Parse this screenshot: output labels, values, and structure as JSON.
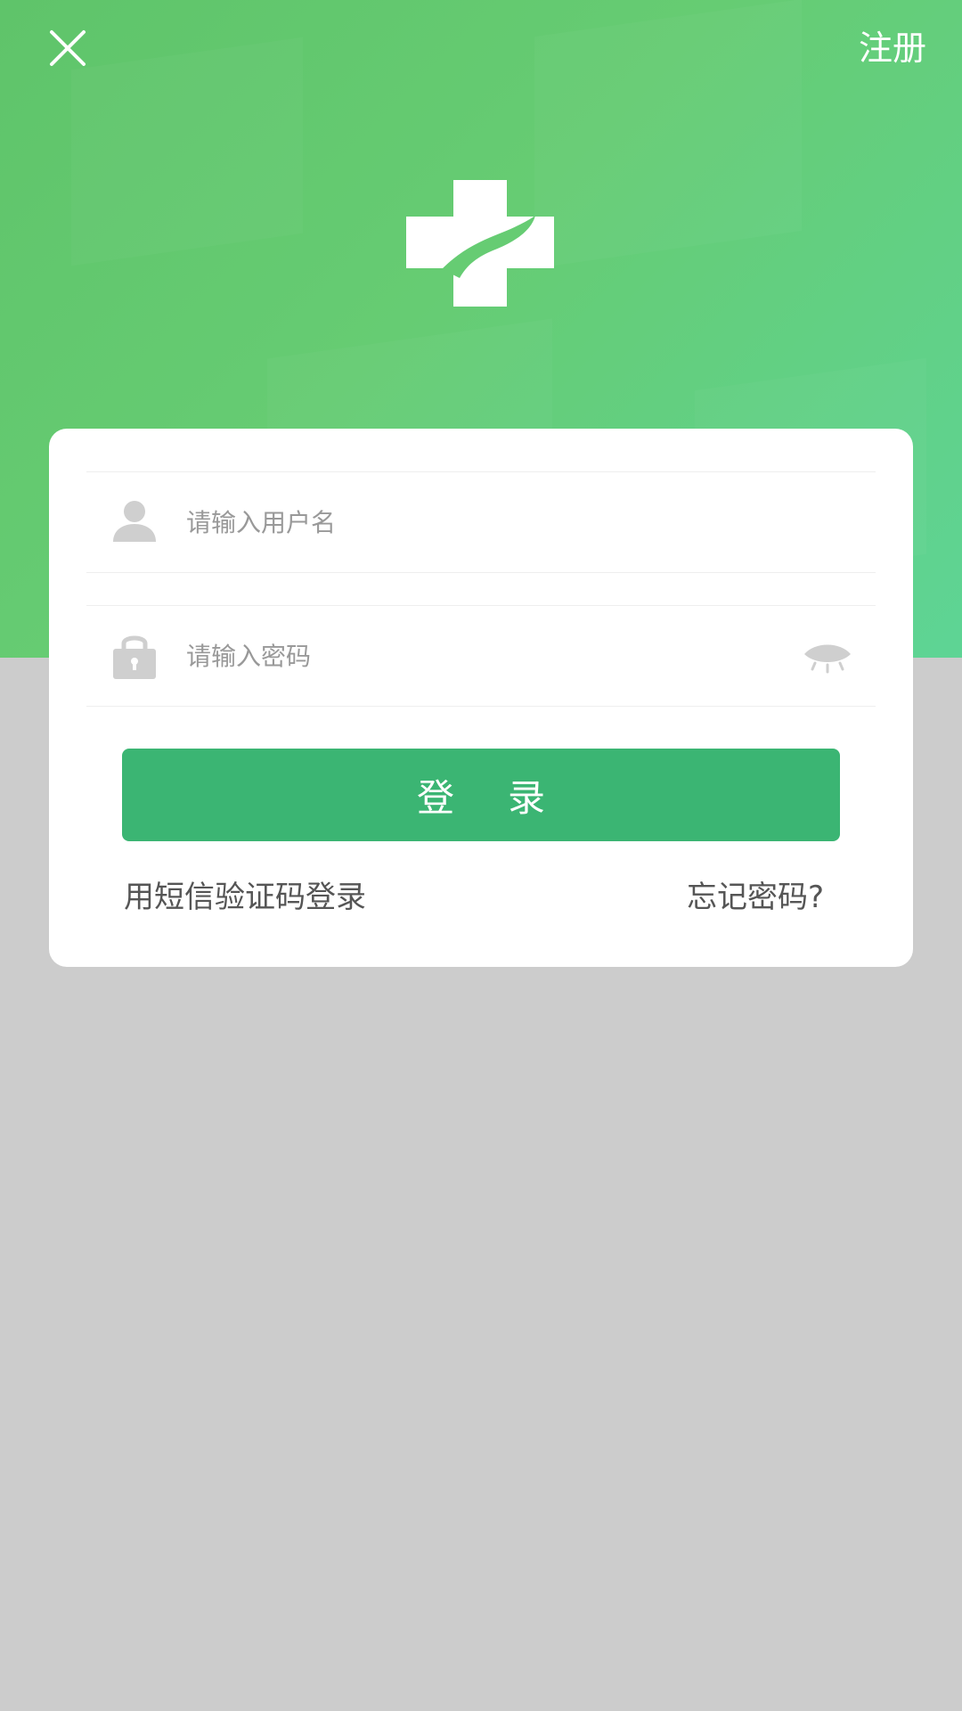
{
  "header": {
    "close_icon": "close-icon",
    "register_label": "注册"
  },
  "logo": {
    "icon": "medical-cross-hand-icon"
  },
  "form": {
    "username": {
      "icon": "user-icon",
      "placeholder": "请输入用户名",
      "value": ""
    },
    "password": {
      "icon": "lock-icon",
      "placeholder": "请输入密码",
      "value": "",
      "toggle_icon": "eye-closed-icon"
    },
    "login_label": "登录",
    "sms_login_label": "用短信验证码登录",
    "forgot_password_label": "忘记密码?"
  },
  "colors": {
    "header_green": "#66cc73",
    "primary_button": "#3bb573",
    "background_gray": "#cccccc",
    "card_white": "#ffffff"
  }
}
